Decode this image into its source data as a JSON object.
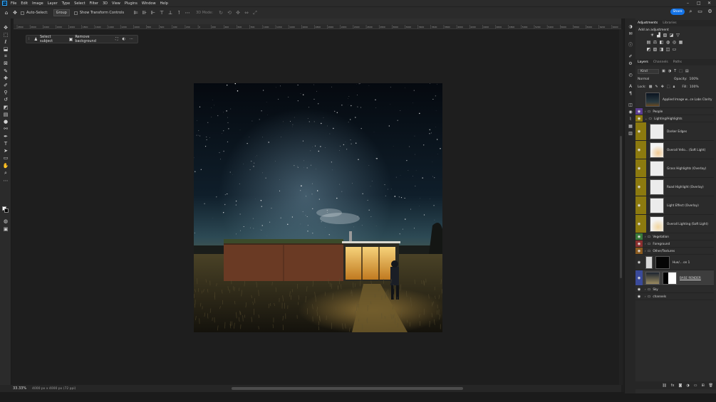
{
  "app": {
    "logo": "Ps"
  },
  "menubar": {
    "items": [
      "File",
      "Edit",
      "Image",
      "Layer",
      "Type",
      "Select",
      "Filter",
      "3D",
      "View",
      "Plugins",
      "Window",
      "Help"
    ],
    "window_controls": [
      "–",
      "□",
      "✕"
    ]
  },
  "options_bar": {
    "auto_select_label": "Auto-Select:",
    "auto_select_value": "Group",
    "show_transform_label": "Show Transform Controls",
    "mode_3d_label": "3D Mode:",
    "share_label": "Share"
  },
  "contextual_taskbar": {
    "select_subject": "Select subject",
    "remove_background": "Remove background"
  },
  "status": {
    "zoom": "33.33%",
    "doc_info": "4000 px x 4000 px (72 ppi)"
  },
  "ruler_labels": [
    "2800",
    "2600",
    "2400",
    "2200",
    "2000",
    "1800",
    "1600",
    "1400",
    "1200",
    "1000",
    "800",
    "600",
    "400",
    "200",
    "0",
    "200",
    "400",
    "600",
    "800",
    "1000",
    "1200",
    "1400",
    "1600",
    "1800",
    "2000",
    "2200",
    "2400",
    "2600",
    "2800",
    "3000",
    "3200",
    "3400",
    "3600",
    "3800",
    "4000",
    "4200",
    "4400",
    "4600",
    "4800",
    "5000",
    "5200",
    "5400",
    "5600",
    "5800",
    "6000",
    "6200",
    "6400"
  ],
  "panels": {
    "adjustments_tabs": [
      "Adjustments",
      "Libraries"
    ],
    "add_adjustment": "Add an adjustment",
    "layers_tabs": [
      "Layers",
      "Channels",
      "Paths"
    ],
    "kind_label": "Kind",
    "blend_mode": "Normal",
    "opacity_label": "Opacity:",
    "opacity_value": "100%",
    "lock_label": "Lock:",
    "fill_label": "Fill:",
    "fill_value": "100%"
  },
  "layers": [
    {
      "name": "Applied Image w...ce Labs Clarity",
      "type": "image",
      "color": ""
    },
    {
      "name": "People",
      "type": "group",
      "color": "#5b3c8f"
    },
    {
      "name": "Lighting/Highlights",
      "type": "group-open",
      "color": "#8c7a0f"
    },
    {
      "name": "Darker Edges",
      "type": "child",
      "color": "#8c7a0f"
    },
    {
      "name": "Overall Yello... (Soft Light)",
      "type": "child",
      "color": "#8c7a0f"
    },
    {
      "name": "Grass Highlights (Overlay)",
      "type": "child",
      "color": "#8c7a0f"
    },
    {
      "name": "Road Highlight (Overlay)",
      "type": "child",
      "color": "#8c7a0f"
    },
    {
      "name": "Light Effect (Overlay)",
      "type": "child",
      "color": "#8c7a0f"
    },
    {
      "name": "Overall Lighting (Soft Light)",
      "type": "child",
      "color": "#8c7a0f"
    },
    {
      "name": "Vegetation",
      "type": "group",
      "color": "#3a7a3a"
    },
    {
      "name": "Foreground",
      "type": "group",
      "color": "#8a2f2f"
    },
    {
      "name": "Other/Textures",
      "type": "group",
      "color": "#8a5a1f"
    },
    {
      "name": "Hue/... on 1",
      "type": "adjust",
      "color": ""
    },
    {
      "name": "BASE RENDER",
      "type": "base",
      "color": "#3a4a9a"
    },
    {
      "name": "Sky",
      "type": "group",
      "color": ""
    },
    {
      "name": "channels",
      "type": "group",
      "color": ""
    }
  ],
  "colors": {
    "accent": "#1473e6",
    "panel": "#2b2b2b",
    "background": "#1e1e1e"
  }
}
